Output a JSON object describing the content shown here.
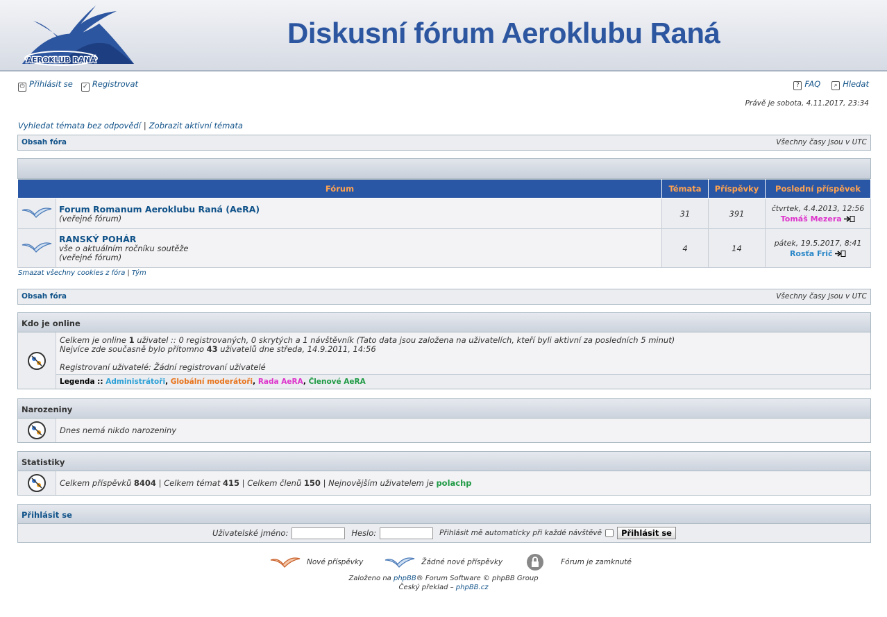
{
  "header": {
    "title": "Diskusní fórum Aeroklubu Raná",
    "logo_text": "AEROKLUB RANÁ"
  },
  "toplinks": {
    "login": "Přihlásit se",
    "register": "Registrovat",
    "faq": "FAQ",
    "search": "Hledat"
  },
  "datetime": "Právě je sobota, 4.11.2017, 23:34",
  "searchlinks": {
    "unanswered": "Vyhledat témata bez odpovědí",
    "sep": "|",
    "active": "Zobrazit aktivní témata"
  },
  "navbar": {
    "index": "Obsah fóra",
    "tz": "Všechny časy jsou v UTC"
  },
  "table": {
    "headers": [
      "Fórum",
      "Témata",
      "Příspěvky",
      "Poslední příspěvek"
    ],
    "rows": [
      {
        "title": "Forum Romanum Aeroklubu Raná (AeRA)",
        "desc1": "(veřejné fórum)",
        "desc2": "",
        "topics": "31",
        "posts": "391",
        "last_date": "čtvrtek, 4.4.2013, 12:56",
        "last_user": "Tomáš Mezera",
        "user_color": "#dd33cc"
      },
      {
        "title": "RANSKÝ POHÁR",
        "desc1": "vše o aktuálním ročníku soutěže",
        "desc2": "(veřejné fórum)",
        "topics": "4",
        "posts": "14",
        "last_date": "pátek, 19.5.2017, 8:41",
        "last_user": "Rosťa Frič",
        "user_color": "#2a87c8"
      }
    ]
  },
  "bottomlinks": {
    "cookies": "Smazat všechny cookies z fóra",
    "sep": "|",
    "team": "Tým"
  },
  "online": {
    "title": "Kdo je online",
    "l1a": "Celkem je online ",
    "l1b": "1",
    "l1c": " uživatel :: 0 registrovaných, 0 skrytých a 1 návštěvník (Tato data jsou založena na uživatelích, kteří byli aktivní za posledních 5 minut)",
    "l2a": "Nejvíce zde současně bylo přítomno ",
    "l2b": "43",
    "l2c": " uživatelů dne středa, 14.9.2011, 14:56",
    "l3": "Registrovaní uživatelé: Žádní registrovaní uživatelé",
    "legend_label": "Legenda :: ",
    "legend": [
      {
        "name": "Administrátoři",
        "color": "#2a9fd6"
      },
      {
        "name": "Globální moderátoři",
        "color": "#e8731c"
      },
      {
        "name": "Rada AeRA",
        "color": "#dd33cc"
      },
      {
        "name": "Členové AeRA",
        "color": "#1f9a45"
      }
    ]
  },
  "birthdays": {
    "title": "Narozeniny",
    "text": "Dnes nemá nikdo narozeniny"
  },
  "stats": {
    "title": "Statistiky",
    "a": "Celkem příspěvků ",
    "posts": "8404",
    "b": " | Celkem témat ",
    "topics": "415",
    "c": " | Celkem členů ",
    "members": "150",
    "d": " | Nejnovějším uživatelem je ",
    "newest": "polachp"
  },
  "login": {
    "title": "Přihlásit se",
    "user_label": "Uživatelské jméno:",
    "pass_label": "Heslo:",
    "auto_label": "Přihlásit mě automaticky při každé návštěvě",
    "button": "Přihlásit se"
  },
  "legendbar": {
    "new": "Nové příspěvky",
    "nonew": "Žádné nové příspěvky",
    "locked": "Fórum je zamknuté"
  },
  "footer": {
    "l1a": "Založeno na ",
    "l1b": "phpBB",
    "l1c": "® Forum Software © phpBB Group",
    "l2a": "Český překlad – ",
    "l2b": "phpBB.cz"
  }
}
